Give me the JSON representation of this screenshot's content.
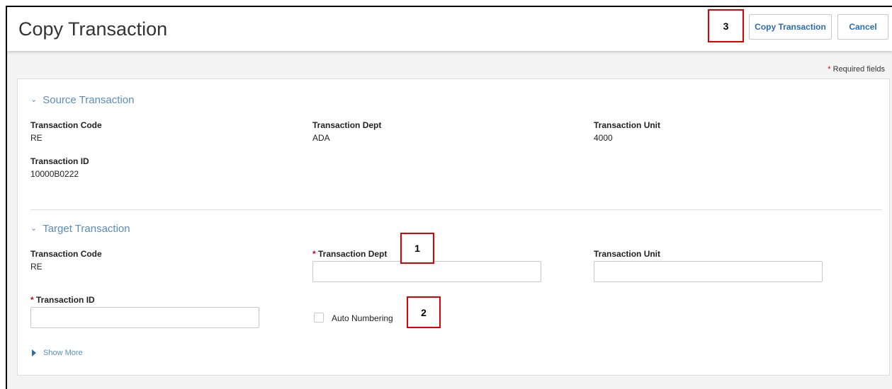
{
  "page": {
    "title": "Copy Transaction",
    "copy_button_label": "Copy Transaction",
    "cancel_button_label": "Cancel",
    "required_star": "*",
    "required_note": "Required fields"
  },
  "callouts": [
    "1",
    "2",
    "3"
  ],
  "source_section": {
    "title": "Source Transaction",
    "fields": {
      "code_label": "Transaction Code",
      "code_value": "RE",
      "dept_label": "Transaction Dept",
      "dept_value": "ADA",
      "unit_label": "Transaction Unit",
      "unit_value": "4000",
      "id_label": "Transaction ID",
      "id_value": "10000B0222"
    }
  },
  "target_section": {
    "title": "Target Transaction",
    "code_label": "Transaction Code",
    "code_value": "RE",
    "dept_label": "Transaction Dept",
    "dept_value": "",
    "unit_label": "Transaction Unit",
    "unit_value": "",
    "id_label": "Transaction ID",
    "id_value": "",
    "auto_numbering_label": "Auto Numbering",
    "auto_numbering_checked": false,
    "show_more_label": "Show More"
  },
  "icons": {
    "section_toggle": "chevron-down-icon",
    "show_more": "caret-right-icon"
  },
  "colors": {
    "accent": "#5a8db8",
    "button_text": "#2b6cb0",
    "required": "#d0021b",
    "callout_border": "#e00000"
  }
}
